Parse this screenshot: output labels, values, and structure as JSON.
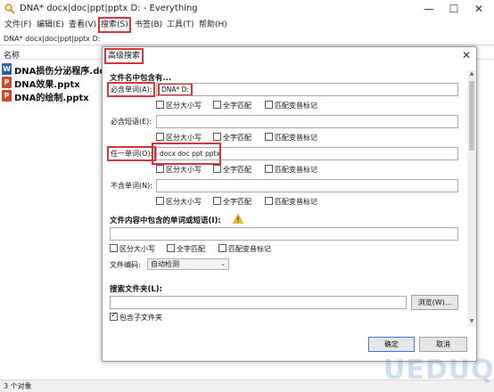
{
  "window": {
    "title": "DNA* docx|doc|ppt|pptx D: - Everything",
    "min_glyph": "—",
    "max_glyph": "☐",
    "close_glyph": "✕"
  },
  "menu": [
    "文件(F)",
    "编辑(E)",
    "查看(V)",
    "搜索(S)",
    "书签(B)",
    "工具(T)",
    "帮助(H)"
  ],
  "search_query": "DNA* docx|doc|ppt|pptx D:",
  "columns": {
    "name": "名称"
  },
  "files": [
    {
      "icon": "word",
      "icon_letter": "W",
      "name": "DNA损伤分泌程序.docx"
    },
    {
      "icon": "ppt",
      "icon_letter": "P",
      "name": "DNA效果.pptx"
    },
    {
      "icon": "ppt",
      "icon_letter": "P",
      "name": "DNA的绘制.pptx"
    }
  ],
  "status": "3 个对象",
  "dialog": {
    "title": "高级搜索",
    "close_glyph": "✕",
    "section_filename": "文件名中包含有...",
    "must_words_label": "必含单词(A):",
    "must_words_value": "DNA* D:",
    "must_phrase_label": "必含短语(E):",
    "must_phrase_value": "",
    "any_words_label": "任一单词(O):",
    "any_words_value": "docx doc ppt pptx",
    "not_words_label": "不含单词(N):",
    "not_words_value": "",
    "opt_case": "区分大小写",
    "opt_whole": "全字匹配",
    "opt_diacritics": "匹配变音标记",
    "section_content": "文件内容中包含的单词或短语(I):",
    "content_value": "",
    "encoding_label": "文件编码:",
    "encoding_value": "自动检测",
    "section_folder": "搜索文件夹(L):",
    "folder_value": "",
    "browse_label": "浏览(W)...",
    "subfolders_label": "包含子文件夹",
    "subfolders_checked": true,
    "ok_label": "确定",
    "cancel_label": "取消"
  },
  "watermark": "UEDUQ"
}
